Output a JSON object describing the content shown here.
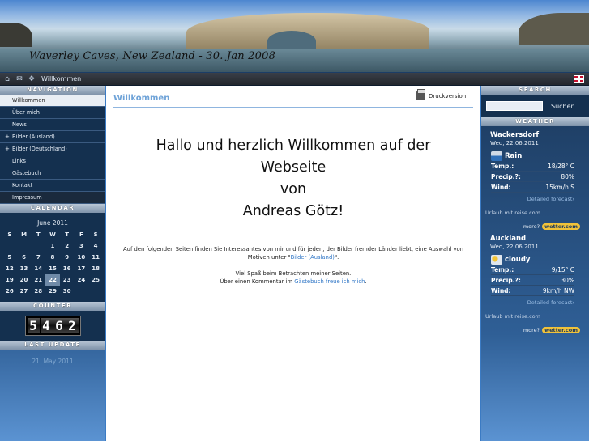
{
  "banner": {
    "caption": "Waverley Caves, New Zealand - 30. Jan 2008"
  },
  "toolbar": {
    "breadcrumb": "Willkommen",
    "icons": [
      "home-icon",
      "mail-icon",
      "sitemap-icon"
    ],
    "flag": "uk-flag-icon"
  },
  "navigation": {
    "title": "NAVIGATION",
    "items": [
      {
        "label": "Willkommen",
        "active": true,
        "expandable": false
      },
      {
        "label": "Über mich",
        "active": false,
        "expandable": false
      },
      {
        "label": "News",
        "active": false,
        "expandable": false
      },
      {
        "label": "Bilder (Ausland)",
        "active": false,
        "expandable": true
      },
      {
        "label": "Bilder (Deutschland)",
        "active": false,
        "expandable": true
      },
      {
        "label": "Links",
        "active": false,
        "expandable": false
      },
      {
        "label": "Gästebuch",
        "active": false,
        "expandable": false
      },
      {
        "label": "Kontakt",
        "active": false,
        "expandable": false
      },
      {
        "label": "Impressum",
        "active": false,
        "expandable": false
      }
    ]
  },
  "calendar": {
    "title": "CALENDAR",
    "month": "June 2011",
    "weekdays": [
      "S",
      "M",
      "T",
      "W",
      "T",
      "F",
      "S"
    ],
    "weeks": [
      [
        "",
        "",
        "",
        "1",
        "2",
        "3",
        "4"
      ],
      [
        "5",
        "6",
        "7",
        "8",
        "9",
        "10",
        "11"
      ],
      [
        "12",
        "13",
        "14",
        "15",
        "16",
        "17",
        "18"
      ],
      [
        "19",
        "20",
        "21",
        "22",
        "23",
        "24",
        "25"
      ],
      [
        "26",
        "27",
        "28",
        "29",
        "30",
        "",
        ""
      ]
    ],
    "today": "22"
  },
  "counter": {
    "title": "COUNTER",
    "digits": [
      "5",
      "4",
      "6",
      "2"
    ]
  },
  "last_update": {
    "title": "LAST UPDATE",
    "date": "21. May 2011"
  },
  "main": {
    "heading": "Willkommen",
    "print_label": "Druckversion",
    "hello_lines": [
      "Hallo und herzlich Willkommen auf der",
      "Webseite",
      "von",
      "Andreas Götz!"
    ],
    "p1_text": "Auf den folgenden Seiten finden Sie Interessantes von mir und für jeden, der Bilder fremder Länder liebt, eine Auswahl von Motiven unter \"",
    "p1_link": "Bilder (Ausland)",
    "p1_end": "\".",
    "p2": "Viel Spaß beim Betrachten meiner Seiten.",
    "p3_text": "Über einen Kommentar im ",
    "p3_link": "Gästebuch freue ich mich",
    "p3_end": "."
  },
  "search": {
    "title": "SEARCH",
    "button": "Suchen",
    "placeholder": ""
  },
  "weather": {
    "title": "WEATHER",
    "locations": [
      {
        "city": "Wackersdorf",
        "date": "Wed, 22.06.2011",
        "condition": "Rain",
        "icon": "rain-icon",
        "temp_label": "Temp.:",
        "temp": "18/28° C",
        "precip_label": "Precip.?:",
        "precip": "80%",
        "wind_label": "Wind:",
        "wind": "15km/h S",
        "forecast": "Detailed forecast›",
        "source": "Urlaub mit reise.com",
        "more": "more?",
        "brand": "wetter.com"
      },
      {
        "city": "Auckland",
        "date": "Wed, 22.06.2011",
        "condition": "cloudy",
        "icon": "cloud-sun-icon",
        "temp_label": "Temp.:",
        "temp": "9/15° C",
        "precip_label": "Precip.?:",
        "precip": "30%",
        "wind_label": "Wind:",
        "wind": "9km/h NW",
        "forecast": "Detailed forecast›",
        "source": "Urlaub mit reise.com",
        "more": "more?",
        "brand": "wetter.com"
      }
    ]
  }
}
